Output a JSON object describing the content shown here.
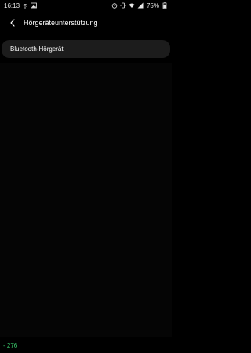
{
  "status_bar": {
    "time": "16:13",
    "left_icons": [
      "wifi-calling-icon",
      "gallery-icon"
    ],
    "right_icons": [
      "alarm-icon",
      "vibrate-icon",
      "wifi-icon",
      "signal-icon"
    ],
    "battery_percent": "75%",
    "battery_icon": "battery-icon"
  },
  "header": {
    "back_icon": "back-chevron-icon",
    "title": "Hörgeräteunterstützung"
  },
  "settings": {
    "items": [
      {
        "label": "Bluetooth-Hörgerät"
      }
    ]
  },
  "footer": {
    "counter": "- 276"
  },
  "colors": {
    "background": "#000000",
    "card": "#1c1c1c",
    "counter": "#3ac96b"
  }
}
